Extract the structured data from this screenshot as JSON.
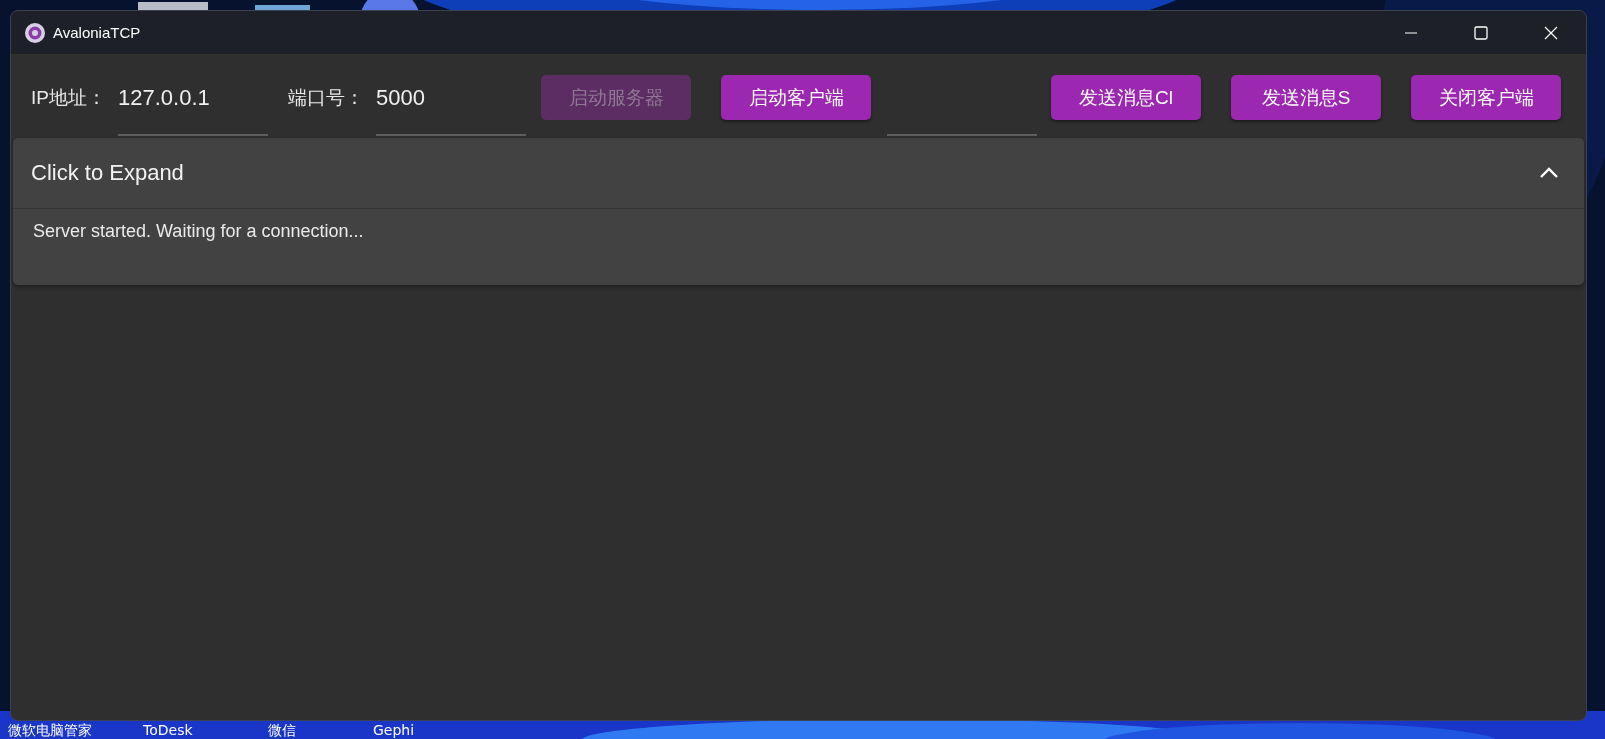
{
  "window": {
    "title": "AvaloniaTCP"
  },
  "toolbar": {
    "fields": [
      {
        "label": "IP地址：",
        "value": "127.0.0.1"
      },
      {
        "label": "端口号：",
        "value": "5000"
      }
    ],
    "buttons": [
      {
        "label": "启动服务器",
        "disabled": true
      },
      {
        "label": "启动客户端",
        "disabled": false
      },
      {
        "label": "发送消息Cl",
        "disabled": false
      },
      {
        "label": "发送消息S",
        "disabled": false
      },
      {
        "label": "关闭客户端",
        "disabled": false
      }
    ]
  },
  "expander": {
    "header": "Click to Expand",
    "expanded": true,
    "content": "Server started. Waiting for a connection..."
  },
  "desktop": {
    "icons": [
      {
        "label": "微软电脑管家"
      },
      {
        "label": "ToDesk"
      },
      {
        "label": "微信"
      },
      {
        "label": "Gephi"
      }
    ]
  }
}
